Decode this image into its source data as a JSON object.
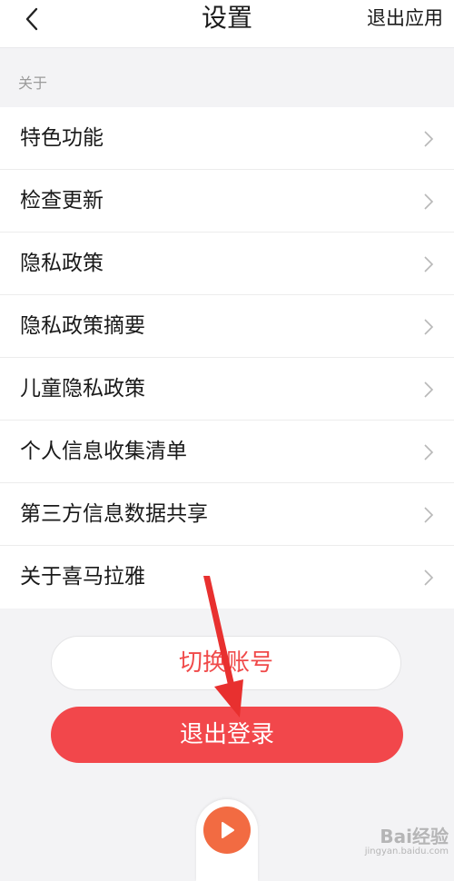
{
  "header": {
    "title": "设置",
    "exit_app_label": "退出应用",
    "back_icon": "chevron-left-icon"
  },
  "section": {
    "label": "关于"
  },
  "menu": {
    "items": [
      {
        "label": "特色功能"
      },
      {
        "label": "检查更新"
      },
      {
        "label": "隐私政策"
      },
      {
        "label": "隐私政策摘要"
      },
      {
        "label": "儿童隐私政策"
      },
      {
        "label": "个人信息收集清单"
      },
      {
        "label": "第三方信息数据共享"
      },
      {
        "label": "关于喜马拉雅"
      }
    ]
  },
  "actions": {
    "switch_account_label": "切换账号",
    "logout_label": "退出登录"
  },
  "player": {
    "icon": "play-icon"
  },
  "watermark": {
    "main": "Bai经验",
    "sub": "jingyan.baidu.com"
  },
  "colors": {
    "accent_red": "#f2474b",
    "switch_text": "#f04a4a",
    "play_orange": "#f26b42",
    "background": "#f3f3f5"
  }
}
